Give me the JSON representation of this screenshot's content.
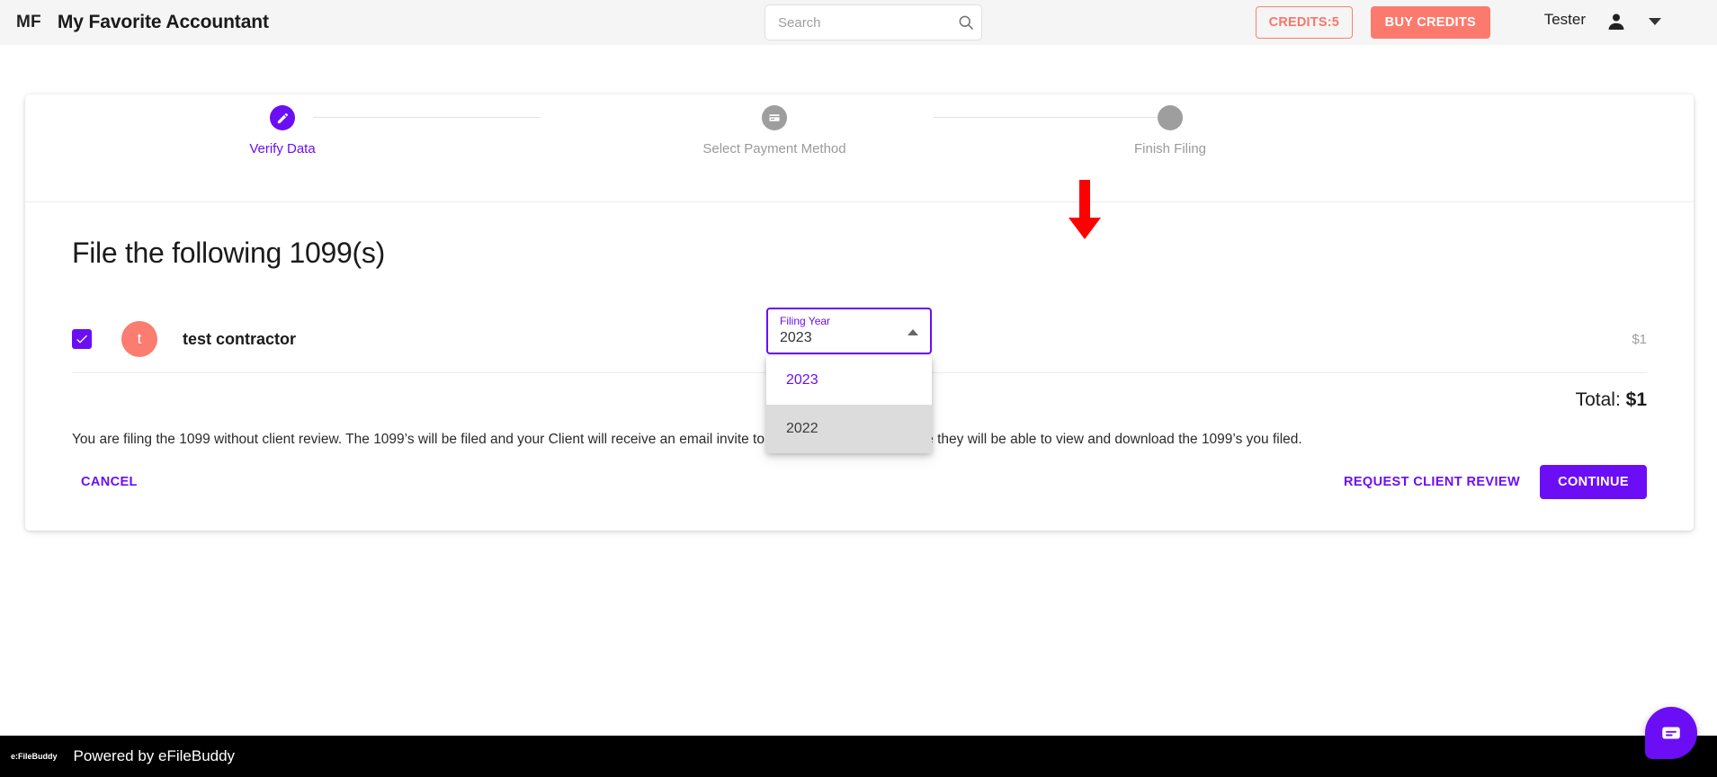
{
  "appbar": {
    "brand_mark": "MF",
    "brand_name": "My Favorite Accountant",
    "search": {
      "value": "",
      "placeholder": "Search",
      "icon": "search-icon"
    },
    "credits_label": "CREDITS:5",
    "buy_credits_label": "BUY CREDITS",
    "user_name": "Tester",
    "user_icon": "person-icon",
    "caret_icon": "chevron-down-icon",
    "colors": {
      "bar_background": "#f5f5f5",
      "credits_border": "#fa8072",
      "credits_text": "#f8766a",
      "buy_credits_bg": "#fc7a6d"
    }
  },
  "stepper": {
    "steps": [
      {
        "label": "Verify Data",
        "state": "active",
        "icon": "pencil-icon"
      },
      {
        "label": "Select Payment Method",
        "state": "inactive",
        "icon": "payment-card-icon"
      },
      {
        "label": "Finish Filing",
        "state": "inactive",
        "icon": "blank-circle-icon"
      }
    ],
    "active_color": "#6b0ef5",
    "inactive_color": "#9e9e9e"
  },
  "main": {
    "page_title": "File the following 1099(s)",
    "filing_row": {
      "checkbox_checked": true,
      "avatar_initial": "t",
      "avatar_color": "#fa7d70",
      "contractor_name": "test contractor",
      "price": "$1"
    },
    "filing_year_select": {
      "label": "Filing Year",
      "value": "2023",
      "open": true,
      "caret_icon": "chevron-up-icon",
      "options": [
        {
          "label": "2023",
          "state": "selected"
        },
        {
          "label": "2022",
          "state": "hovered"
        }
      ]
    },
    "total_prefix": "Total: ",
    "total_amount": "$1",
    "disclaimer": "You are filing the 1099 without client review. The 1099’s will be filed and your Client will receive an email invite to their personal portal where they will be able to view and download the 1099’s you filed.",
    "cancel_label": "CANCEL",
    "request_review_label": "REQUEST CLIENT REVIEW",
    "continue_label": "CONTINUE",
    "accent_color": "#6b0ef5"
  },
  "annotation": {
    "arrow_icon": "red-down-arrow-icon",
    "arrow_color": "#ff0000"
  },
  "footer": {
    "logo_text": "e:FileBuddy",
    "text": "Powered by eFileBuddy",
    "background": "#000000"
  },
  "chat_widget": {
    "icon": "chat-message-icon",
    "color": "#6b0ef5"
  }
}
